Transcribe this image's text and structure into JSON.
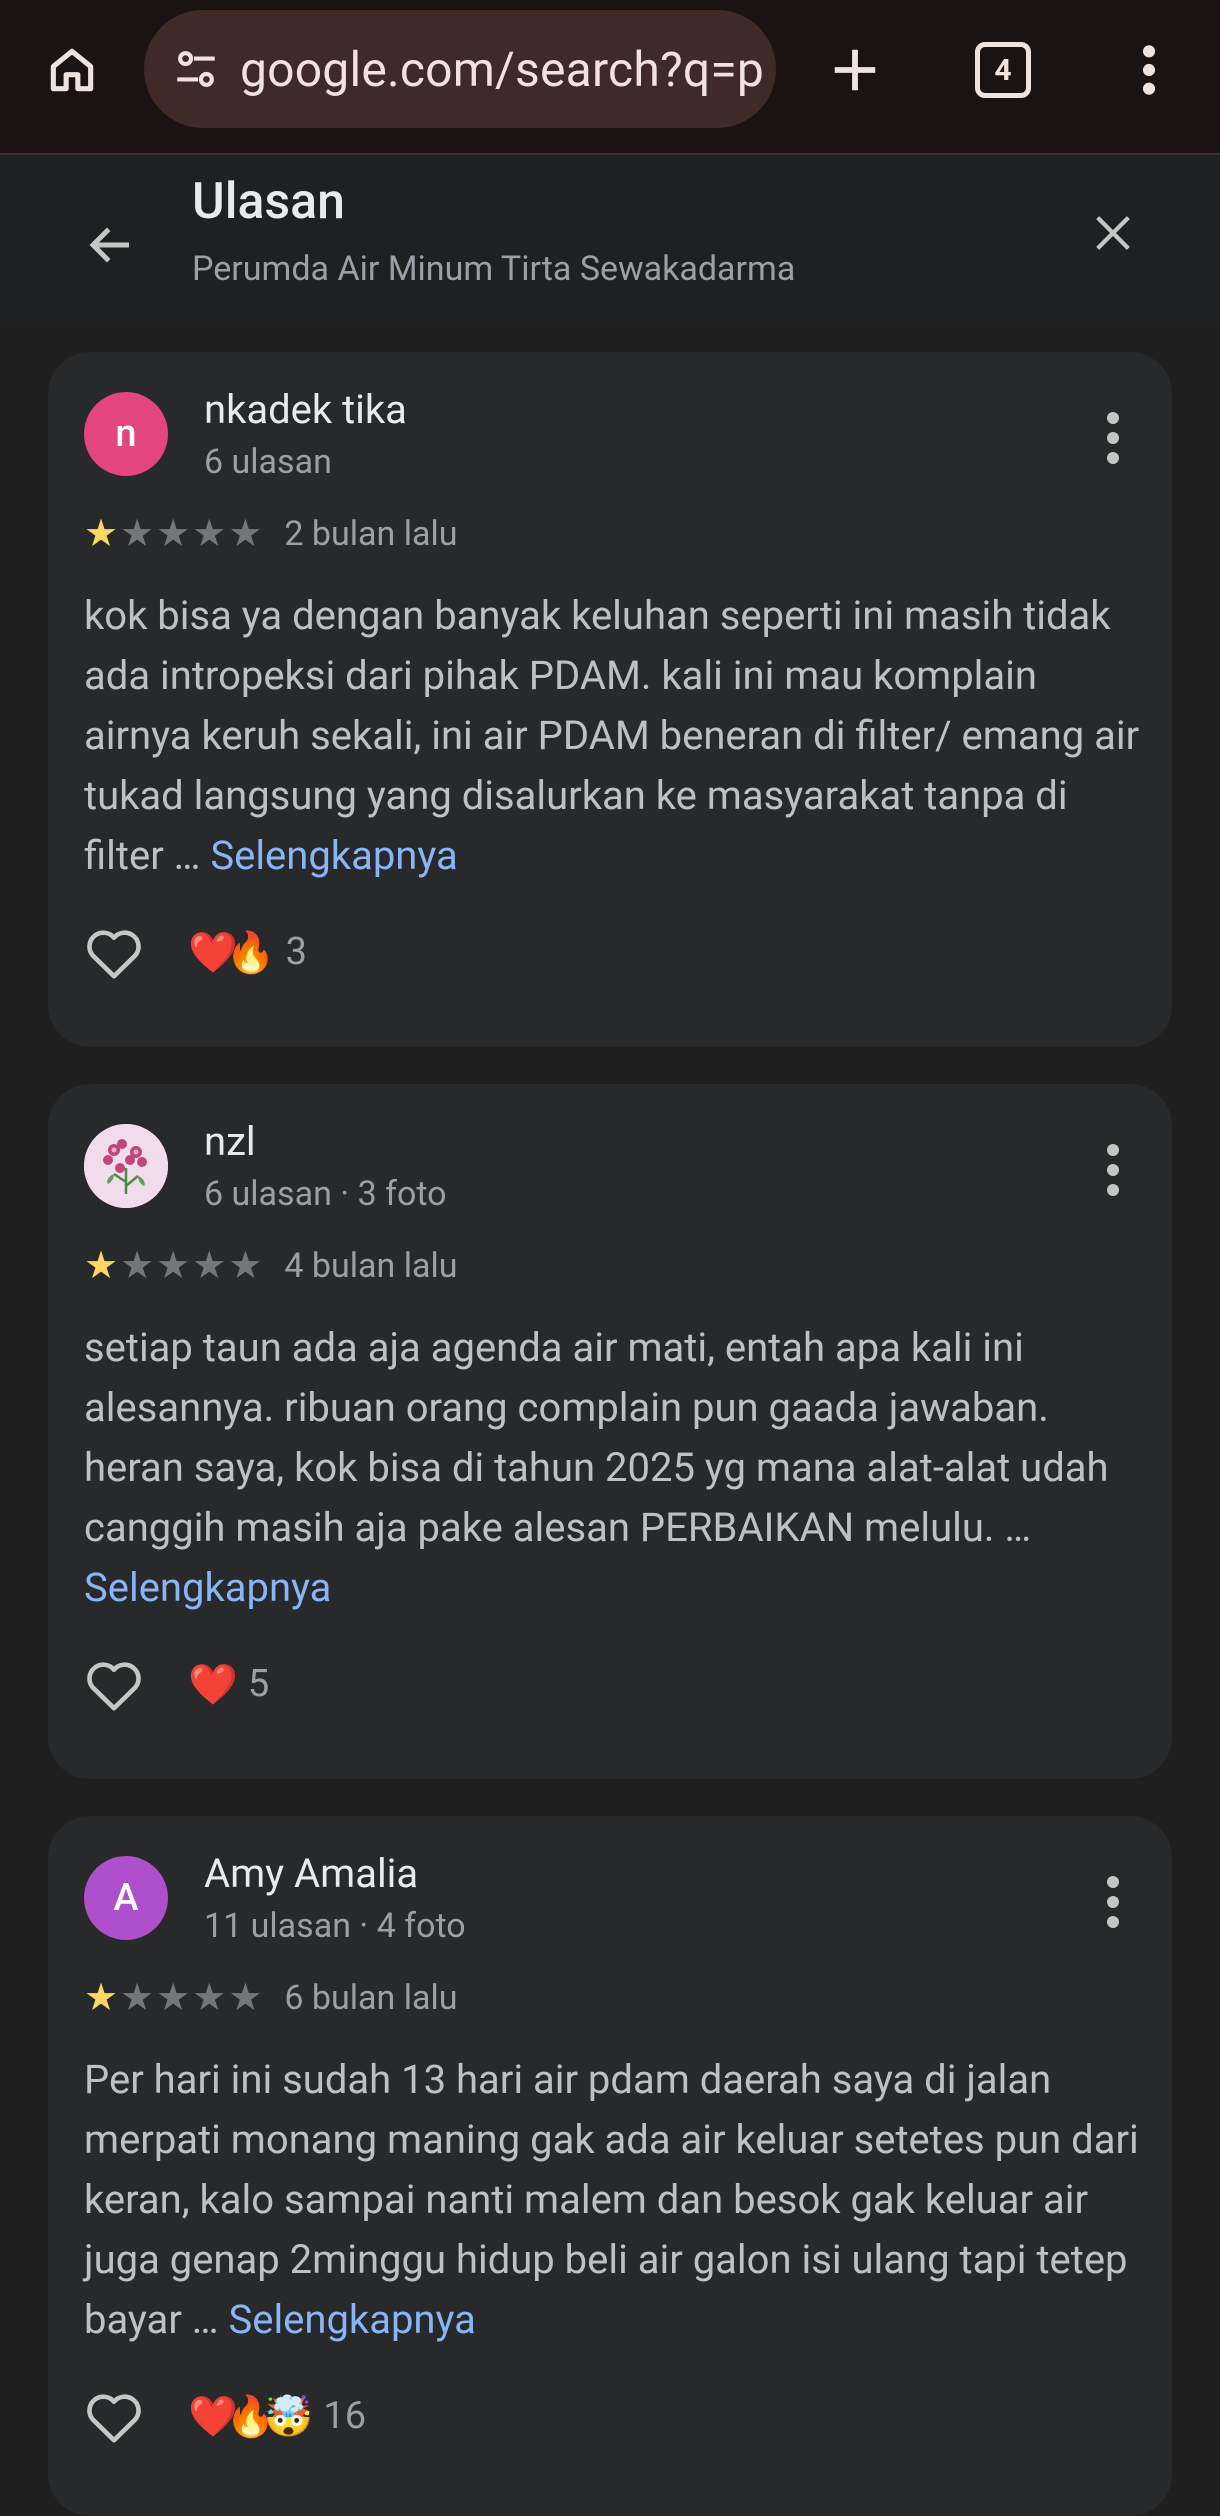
{
  "browser": {
    "url": "google.com/search?q=p",
    "tab_count": "4"
  },
  "panel": {
    "title": "Ulasan",
    "subtitle": "Perumda Air Minum Tirta Sewakadarma"
  },
  "reviews": [
    {
      "avatar_letter": "n",
      "avatar_color": "#e5457f",
      "name": "nkadek tika",
      "meta": "6 ulasan",
      "rating": 1,
      "date": "2 bulan lalu",
      "text": "kok bisa ya dengan banyak keluhan seperti ini masih tidak ada intropeksi dari pihak PDAM. kali ini mau komplain airnya keruh sekali, ini air PDAM beneran di filter/ emang air tukad langsung yang disalurkan ke masyarakat tanpa di filter … ",
      "more_label": "Selengkapnya",
      "reactions": "❤️🔥",
      "reaction_count": "3"
    },
    {
      "avatar_letter": "",
      "avatar_color": "#e8cfe0",
      "name": "nzl",
      "meta": "6 ulasan · 3 foto",
      "rating": 1,
      "date": "4 bulan lalu",
      "text": "setiap taun ada aja agenda air mati, entah apa kali ini alesannya. ribuan orang complain pun gaada jawaban. heran saya, kok bisa di tahun 2025 yg mana alat-alat udah canggih masih aja pake alesan PERBAIKAN melulu. … ",
      "more_label": "Selengkapnya",
      "reactions": "❤️",
      "reaction_count": "5"
    },
    {
      "avatar_letter": "A",
      "avatar_color": "#b04fcb",
      "name": "Amy Amalia",
      "meta": "11 ulasan · 4 foto",
      "rating": 1,
      "date": "6 bulan lalu",
      "text": "Per hari ini sudah 13 hari air pdam daerah saya di jalan merpati monang maning gak ada air keluar setetes pun dari keran, kalo sampai nanti malem dan besok gak keluar air juga genap 2minggu hidup beli air galon isi ulang tapi tetep bayar … ",
      "more_label": "Selengkapnya",
      "reactions": "❤️🔥🤯",
      "reaction_count": "16"
    }
  ]
}
